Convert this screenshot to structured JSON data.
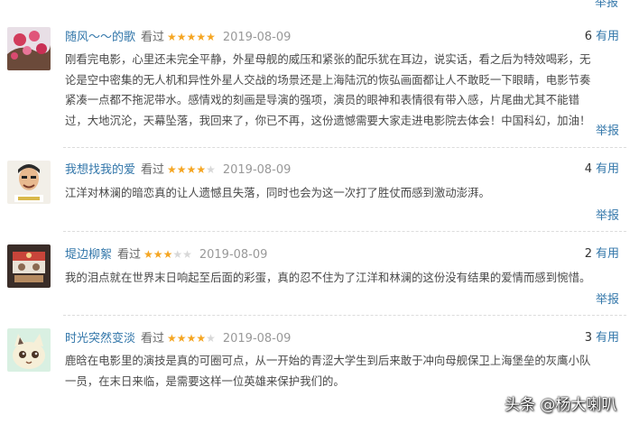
{
  "top_report_label": "举报",
  "reviews": [
    {
      "user": "随风～～的歌",
      "status": "看过",
      "rating": 5,
      "date": "2019-08-09",
      "useful_count": "6",
      "useful_label": "有用",
      "lines": [
        "刚看完电影，心里还未完全平静，外星母舰的威压和紧张的配乐犹在耳边，说实话，看之后为特效喝彩，无",
        "论是空中密集的无人机和异性外星人交战的场景还是上海陆沉的恢弘画面都让人不敢眨一下眼睛，电影节奏",
        "紧凑一点都不拖泥带水。感情戏的刻画是导演的强项，演员的眼神和表情很有带入感，片尾曲尤其不能错",
        "过，大地沉沦，天幕坠落，我回来了，你已不再，这份遗憾需要大家走进电影院去体会！中国科幻，加油！"
      ],
      "report": "举报"
    },
    {
      "user": "我想找我的爱",
      "status": "看过",
      "rating": 4,
      "date": "2019-08-09",
      "useful_count": "4",
      "useful_label": "有用",
      "lines": [
        "江洋对林澜的暗恋真的让人遗憾且失落，同时也会为这一次打了胜仗而感到激动澎湃。"
      ],
      "report": "举报"
    },
    {
      "user": "堤边柳絮",
      "status": "看过",
      "rating": 3,
      "date": "2019-08-09",
      "useful_count": "2",
      "useful_label": "有用",
      "lines": [
        "我的泪点就在世界末日响起至后面的彩蛋，真的忍不住为了江洋和林澜的这份没有结果的爱情而感到惋惜。"
      ],
      "report": "举报"
    },
    {
      "user": "时光突然变淡",
      "status": "看过",
      "rating": 4,
      "date": "2019-08-09",
      "useful_count": "3",
      "useful_label": "有用",
      "lines": [
        "鹿晗在电影里的演技是真的可圈可点，从一开始的青涩大学生到后来敢于冲向母舰保卫上海堡垒的灰鹰小队",
        "一员，在末日来临，是需要这样一位英雄来保护我们的。"
      ]
    }
  ],
  "watermark": "头条 @杨大喇叭"
}
